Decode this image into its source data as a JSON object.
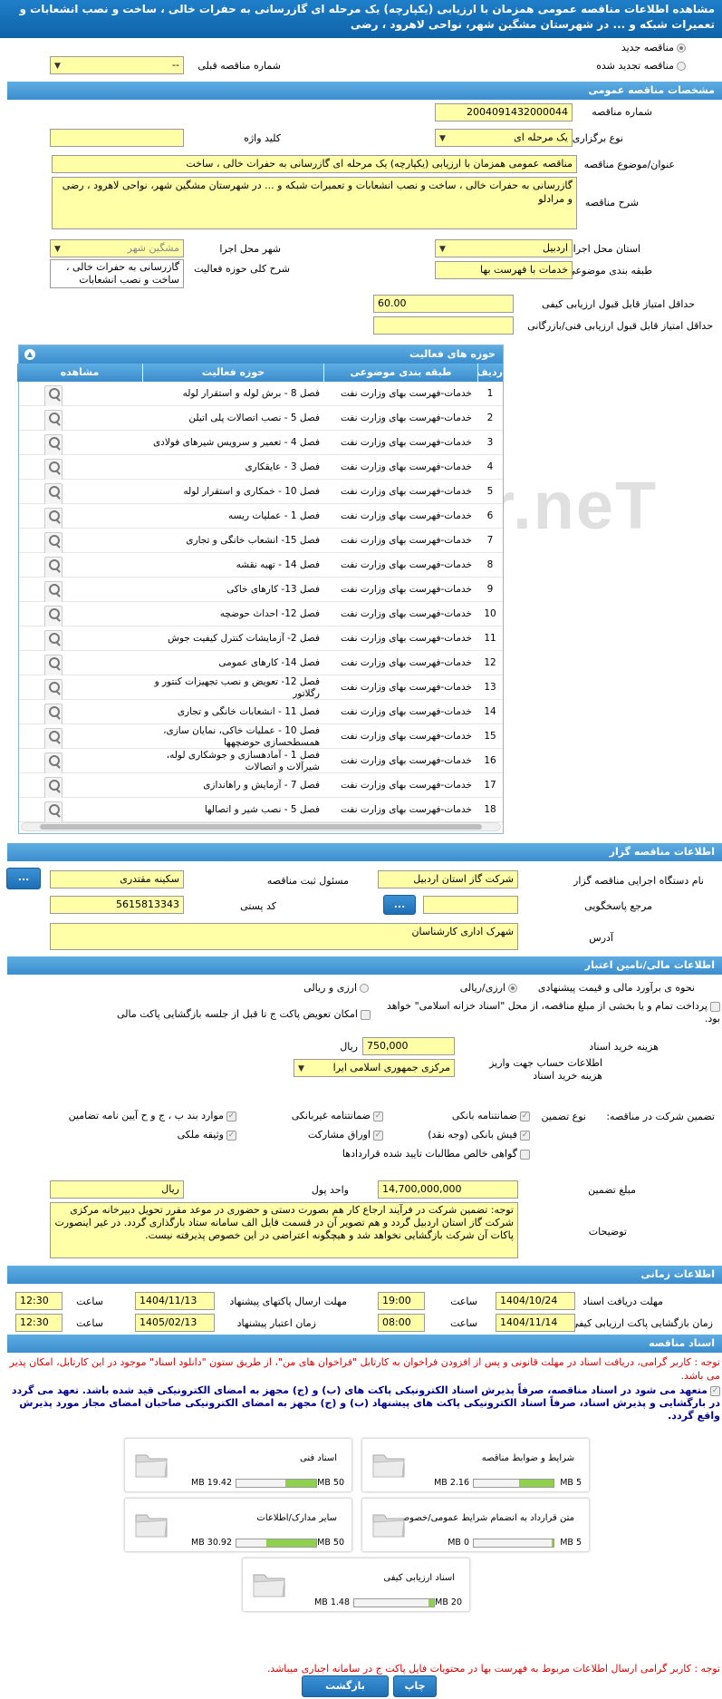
{
  "page_title": "مشاهده اطلاعات مناقصه عمومی همزمان با ارزیابی (یکپارچه) یک مرحله ای گازرسانی به حفرات خالی ، ساخت و نصب انشعابات و تعمیرات شبکه و ... در شهرستان مشگین شهر، نواحی لاهرود ، رضی",
  "top": {
    "radio_new": "مناقصه جدید",
    "radio_renew": "مناقصه تجدید شده",
    "prev_no_label": "شماره مناقصه قبلی",
    "prev_no_value": "--"
  },
  "general": {
    "header": "مشخصات مناقصه عمومی",
    "no_label": "شماره مناقصه",
    "no_value": "2004091432000044",
    "type_label": "نوع برگزاری",
    "type_value": "یک مرحله ای",
    "keyword_label": "کلید واژه",
    "keyword_value": "",
    "subject_label": "عنوان/موضوع مناقصه",
    "subject_value": "مناقصه عمومی همزمان با ارزیابی (یکپارچه) یک مرحله ای گازرسانی به حفرات خالی ، ساخت",
    "desc_label": "شرح مناقصه",
    "desc_value": "گازرسانی به حفرات خالی ، ساخت و نصب انشعابات و تعمیرات شبکه و ... در شهرستان مشگین شهر، نواحی لاهرود ، رضی و مرادلو",
    "province_label": "استان محل اجرا",
    "province_value": "اردبیل",
    "city_label": "شهر محل اجرا",
    "city_value": "مشگین شهر",
    "category_label": "طبقه بندی موضوعی",
    "category_value": "خدمات با فهرست بها",
    "activity_label": "شرح کلی حوزه فعالیت",
    "activity_value": "گازرسانی به حفرات خالی ، ساخت و نصب انشعابات",
    "min_quality_label": "حداقل امتیاز قابل قبول ارزیابی کیفی",
    "min_quality_value": "60.00",
    "min_tech_label": "حداقل امتیاز قابل قبول ارزیابی فنی/بازرگانی",
    "min_tech_value": ""
  },
  "activities": {
    "header": "حوزه های فعالیت",
    "columns": [
      "ردیف",
      "طبقه بندی موضوعی",
      "حوزه فعالیت",
      "مشاهده"
    ],
    "rows": [
      {
        "no": "1",
        "cat": "خدمات-فهرست بهای وزارت نفت",
        "act": "فصل 8 - برش لوله و استقرار لوله"
      },
      {
        "no": "2",
        "cat": "خدمات-فهرست بهای وزارت نفت",
        "act": "فصل 5 - نصب اتصالات پلی اتیلن"
      },
      {
        "no": "3",
        "cat": "خدمات-فهرست بهای وزارت نفت",
        "act": "فصل 4 - تعمیر و سرویس شیرهای فولادی"
      },
      {
        "no": "4",
        "cat": "خدمات-فهرست بهای وزارت نفت",
        "act": "فصل 3 - عایقکاری"
      },
      {
        "no": "5",
        "cat": "خدمات-فهرست بهای وزارت نفت",
        "act": "فصل 10 - خمکاری و استقرار لوله"
      },
      {
        "no": "6",
        "cat": "خدمات-فهرست بهای وزارت نفت",
        "act": "فصل 1 - عملیات ریسه"
      },
      {
        "no": "7",
        "cat": "خدمات-فهرست بهای وزارت نفت",
        "act": "فصل 15- انشعاب خانگی و تجاری"
      },
      {
        "no": "8",
        "cat": "خدمات-فهرست بهای وزارت نفت",
        "act": "فصل 14 - تهیه نقشه"
      },
      {
        "no": "9",
        "cat": "خدمات-فهرست بهای وزارت نفت",
        "act": "فصل 13- کارهای خاکی"
      },
      {
        "no": "10",
        "cat": "خدمات-فهرست بهای وزارت نفت",
        "act": "فصل 12- احداث حوضچه"
      },
      {
        "no": "11",
        "cat": "خدمات-فهرست بهای وزارت نفت",
        "act": "فصل 2- آزمایشات کنترل کیفیت جوش"
      },
      {
        "no": "12",
        "cat": "خدمات-فهرست بهای وزارت نفت",
        "act": "فصل 14- کارهای عمومی"
      },
      {
        "no": "13",
        "cat": "خدمات-فهرست بهای وزارت نفت",
        "act": "فصل 12- تعویض و نصب تجهیزات کنتور و رگلاتور"
      },
      {
        "no": "14",
        "cat": "خدمات-فهرست بهای وزارت نفت",
        "act": "فصل 11 - انشعابات خانگی و تجاری"
      },
      {
        "no": "15",
        "cat": "خدمات-فهرست بهای وزارت نفت",
        "act": "فصل 10 - عملیات خاکی، نمایان سازی، همسطحسازی حوضچهها"
      },
      {
        "no": "16",
        "cat": "خدمات-فهرست بهای وزارت نفت",
        "act": "فصل 1 - آمادهسازی و جوشکاری لوله، شیرآلات و اتصالات"
      },
      {
        "no": "17",
        "cat": "خدمات-فهرست بهای وزارت نفت",
        "act": "فصل 7 - آزمایش و راهاندازی"
      },
      {
        "no": "18",
        "cat": "خدمات-فهرست بهای وزارت نفت",
        "act": "فصل 5 - نصب شیر و اتصالها"
      }
    ]
  },
  "organizer": {
    "header": "اطلاعات مناقصه گزار",
    "device_label": "نام دستگاه اجرایی مناقصه گزار",
    "device_value": "شرکت گاز استان اردبیل",
    "resp_label": "مسئول ثبت مناقصه",
    "resp_value": "سکینه  مقتدری",
    "ref_label": "مرجع پاسخگویی",
    "ref_value": "",
    "postal_label": "کد پستی",
    "postal_value": "5615813343",
    "address_label": "آدرس",
    "address_value": "شهرک اداری کارشناسان",
    "more_btn": "..."
  },
  "finance": {
    "header": "اطلاعات مالی/تامین اعتبار",
    "method_label": "نحوه ی برآورد مالی و قیمت پیشنهادی",
    "opt_rial": "ارزی/ریالی",
    "opt_both": "ارزی و ریالی",
    "treasury_text": "پرداخت تمام و یا بخشی از مبلغ مناقصه، از محل \"اسناد خزانه اسلامی\" خواهد بود.",
    "swap_text": "امکان تعویض پاکت ج تا قبل از جلسه بازگشایی پاکت مالی",
    "fee_label": "هزینه خرید اسناد",
    "fee_value": "750,000",
    "fee_unit": "ریال",
    "account_label": "اطلاعات حساب جهت واریز هزینه خرید اسناد",
    "account_value": "مرکزی جمهوری اسلامی ایرا",
    "guarantee_label": "تضمین شرکت در مناقصه:",
    "guarantee_type": "نوع تضمین",
    "g1": "ضمانتنامه بانکی",
    "g2": "ضمانتنامه غیربانکی",
    "g3": "موارد بند ب ، ج و ح آیین نامه تضامین",
    "g4": "فیش بانکی (وجه نقد)",
    "g5": "اوراق مشارکت",
    "g6": "وثیقه ملکی",
    "g7": "گواهی خالص مطالبات تایید شده قراردادها",
    "amount_label": "مبلغ تضمین",
    "amount_value": "14,700,000,000",
    "currency_label": "واحد پول",
    "currency_value": "ریال",
    "notes_label": "توضیحات",
    "notes_value": "توجه: تضمین شرکت در فرآیند ارجاع کار هم بصورت دستی و حضوری در موعد مقرر تحویل دبیرخانه مرکزی شرکت گاز استان اردبیل گردد و هم تصویر آن در قسمت فایل الف سامانه ستاد بارگذاری گردد. در غیر اینصورت پاکات آن شرکت بازگشایی نخواهد شد و هیچگونه اعتراضی در این خصوص پذیرفته نیست."
  },
  "timing": {
    "header": "اطلاعات زمانی",
    "recv_label": "مهلت دریافت اسناد",
    "recv_date": "1404/10/24",
    "recv_time": "19:00",
    "send_label": "مهلت ارسال پاکتهای پیشنهاد",
    "send_date": "1404/11/13",
    "send_time": "12:30",
    "open_label": "زمان بازگشایی پاکت ارزیابی کیفی",
    "open_date": "1404/11/14",
    "open_time": "08:00",
    "valid_label": "زمان اعتبار پیشنهاد",
    "valid_date": "1405/02/13",
    "valid_time": "12:30",
    "time_label": "ساعت"
  },
  "docs": {
    "header": "اسناد مناقصه",
    "notice1": "توجه : کاربر گرامی، دریافت اسناد در مهلت قانونی و پس از افزودن فراخوان به کارتابل \"فراخوان های من\"، از طریق ستون \"دانلود اسناد\" موجود در این کارتابل، امکان پذیر می باشد.",
    "notice2": "متعهد می شود در اسناد مناقصه، صرفاً پذیرش اسناد الکترونیکی پاکت های (ب) و (ج) مجهز به امضای الکترونیکی قید شده باشد. تعهد می گردد در بارگشایی و پذیرش اسناد، صرفاً اسناد الکترونیکی پاکت های پیشنهاد (ب) و (ج) مجهز به امضای الکترونیکی صاحبان امضای مجاز مورد پذیرش واقع گردد.",
    "items": [
      {
        "title": "شرایط و ضوابط مناقصه",
        "current": "2.16 MB",
        "max": "5 MB",
        "fill": 0.43
      },
      {
        "title": "اسناد فنی",
        "current": "19.42 MB",
        "max": "50 MB",
        "fill": 0.39
      },
      {
        "title": "متن قرارداد به انضمام شرایط عمومی/خصوصی",
        "current": "0 MB",
        "max": "5 MB",
        "fill": 0.0
      },
      {
        "title": "سایر مدارک/اطلاعات",
        "current": "30.92 MB",
        "max": "50 MB",
        "fill": 0.62
      },
      {
        "title": "اسناد ارزیابی کیفی",
        "current": "1.48 MB",
        "max": "20 MB",
        "fill": 0.07
      }
    ],
    "notice3": "توجه : کاربر گرامی ارسال اطلاعات مربوط به فهرست بها در محتویات فایل پاکت ج در سامانه اجباری میباشد."
  },
  "buttons": {
    "print": "چاپ",
    "back": "بازگشت"
  },
  "watermark": "AriaTender.neT"
}
